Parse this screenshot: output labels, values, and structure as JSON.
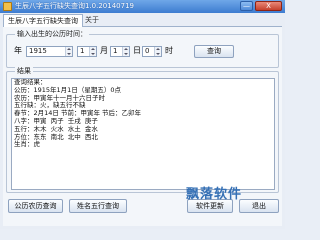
{
  "window": {
    "title": "生辰八字五行缺失查询1.0.20140719",
    "minimize_glyph": "—",
    "close_glyph": "X"
  },
  "tabs": [
    {
      "label": "生辰八字五行缺失查询"
    },
    {
      "label": "关于"
    }
  ],
  "input_group": {
    "title": "输入出生的公历时间：",
    "year_label": "年",
    "year_value": "1915",
    "month_label": "月",
    "month_value": "1",
    "day_label": "日",
    "day_value": "1",
    "hour_label": "时",
    "hour_value": "0",
    "query_button": "查询"
  },
  "result_group": {
    "title": "结果",
    "lines": [
      "查询结果：",
      "公历：1915年1月1日（星期五）0点",
      "农历：甲寅年十一月十六日子时",
      "五行缺：火，缺五行不缺",
      "春节：2月14日 节前：甲寅年 节后：乙卯年",
      "八字：甲寅  丙子  壬戌  庚子",
      "五行：木木  火水  水土  金水",
      "方位：东东  南北  北中  西北",
      "生肖：虎"
    ]
  },
  "buttons": {
    "lunar_query": "公历农历查询",
    "name_query": "姓名五行查询",
    "update": "软件更新",
    "exit": "退出"
  },
  "watermark": "飘落软件"
}
